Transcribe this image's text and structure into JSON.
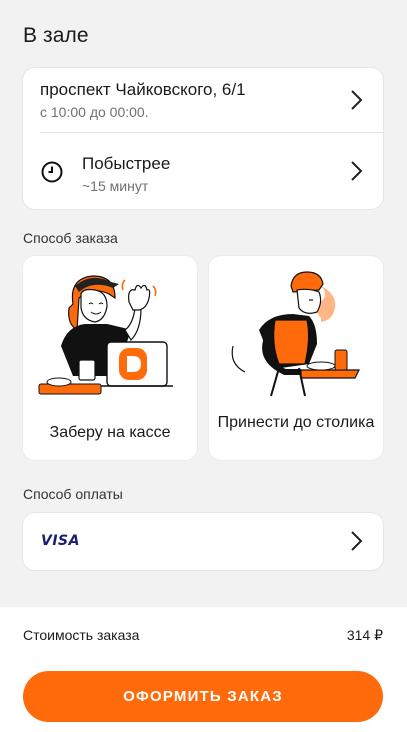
{
  "header": {
    "title": "В зале"
  },
  "restaurant": {
    "address": "проспект Чайковского, 6/1",
    "hours": "с 10:00 до 00:00."
  },
  "timing": {
    "title": "Побыстрее",
    "subtitle": "~15 минут"
  },
  "order_method": {
    "label": "Способ заказа",
    "options": [
      {
        "label": "Заберу на кассе"
      },
      {
        "label": "Принести до столика"
      }
    ]
  },
  "payment": {
    "label": "Способ оплаты",
    "card_brand": "VISA"
  },
  "summary": {
    "cost_label": "Стоимость заказа",
    "cost_value": "314 ₽"
  },
  "actions": {
    "submit_label": "ОФОРМИТЬ ЗАКАЗ"
  },
  "colors": {
    "accent": "#ff6b0b",
    "background": "#f2f2f2",
    "visa": "#1a1f71"
  },
  "icons": [
    "clock-icon",
    "chevron-right-icon"
  ]
}
